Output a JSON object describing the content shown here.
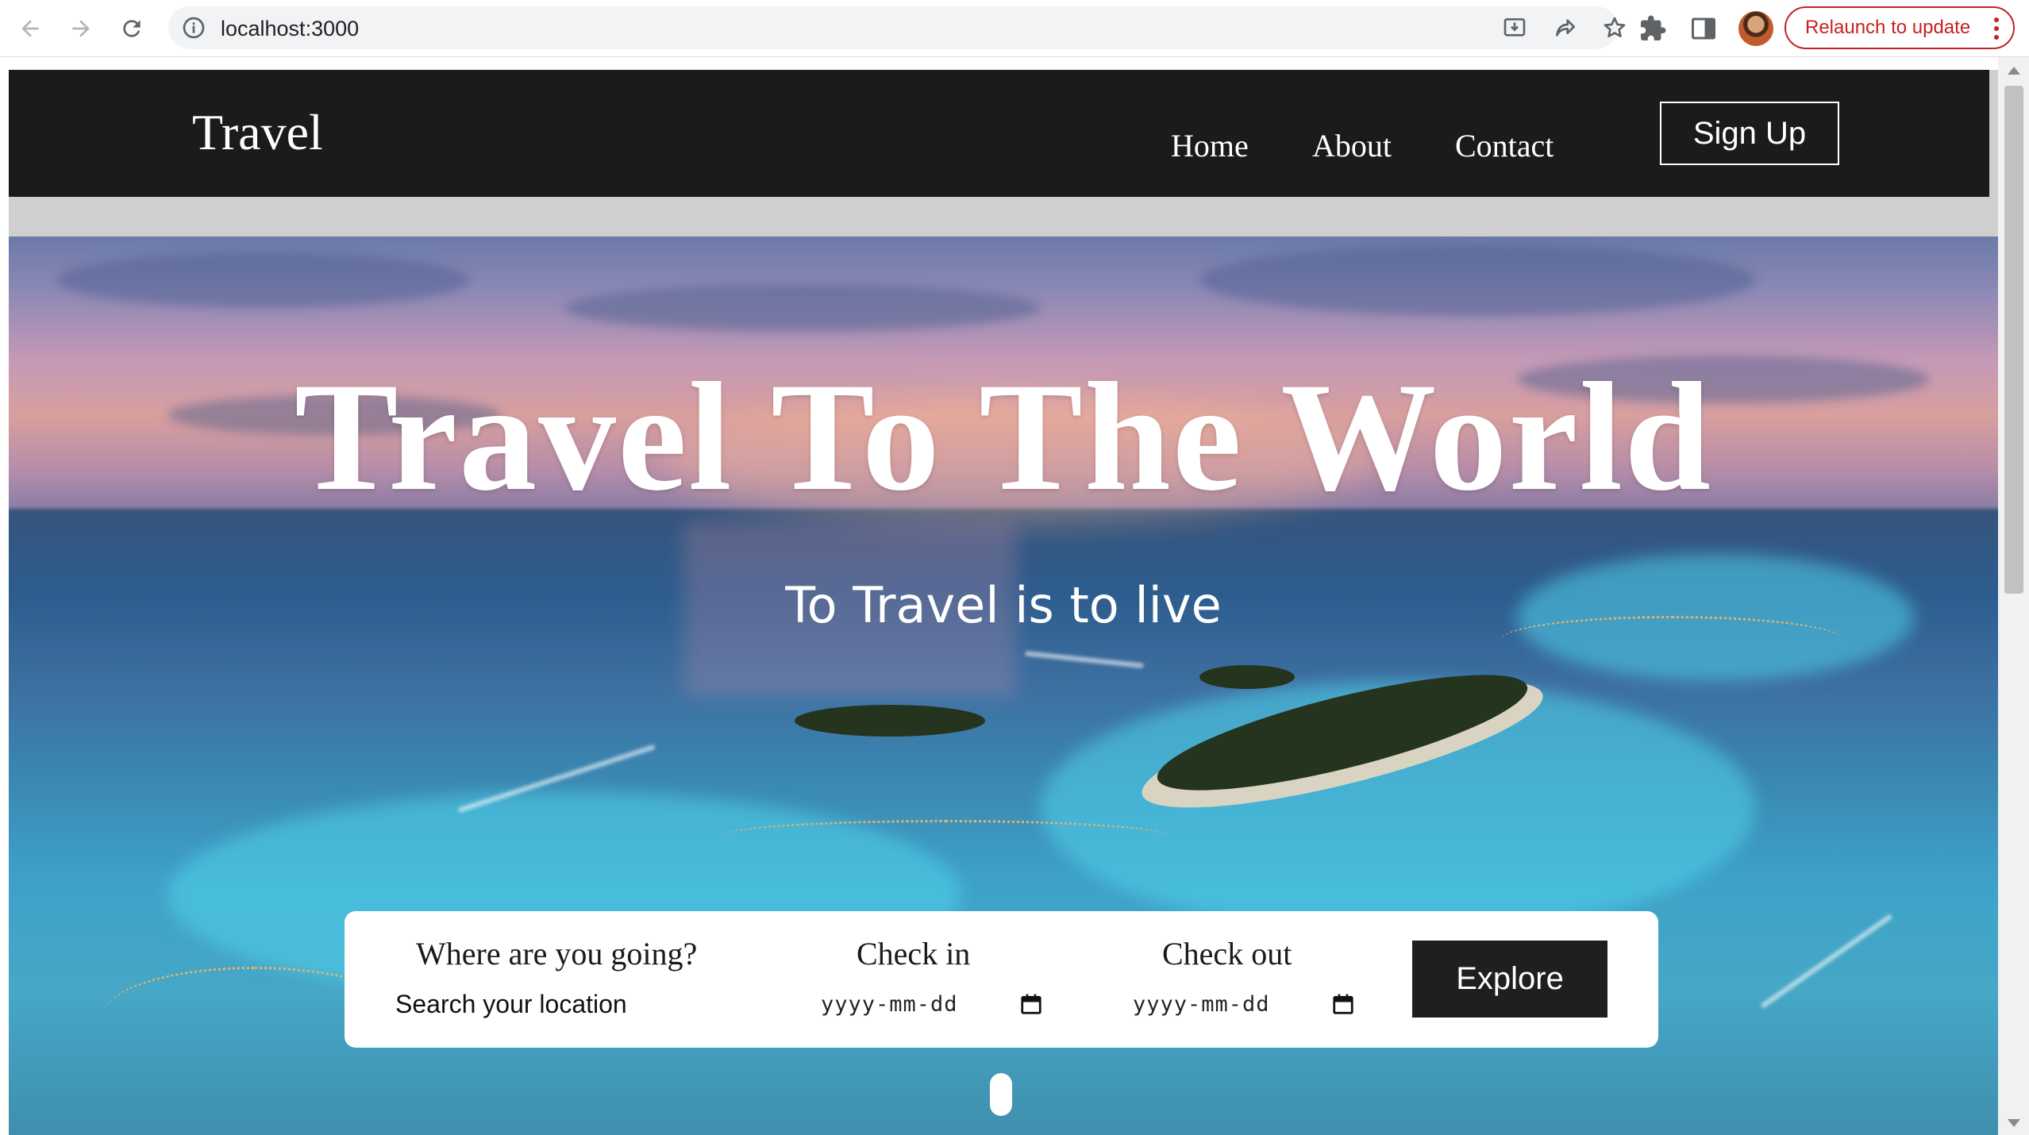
{
  "browser": {
    "url": "localhost:3000",
    "relaunch_label": "Relaunch to update",
    "accent_color": "#c5221f"
  },
  "site": {
    "logo": "Travel",
    "nav": [
      {
        "label": "Home"
      },
      {
        "label": "About"
      },
      {
        "label": "Contact"
      }
    ],
    "signup_label": "Sign Up"
  },
  "hero": {
    "title": "Travel To The World",
    "tagline": "To Travel is to live"
  },
  "search": {
    "location_label": "Where are you going?",
    "location_placeholder": "Search your location",
    "checkin_label": "Check in",
    "checkin_value": "yyyy-mm-dd",
    "checkout_label": "Check out",
    "checkout_value": "yyyy-mm-dd",
    "explore_label": "Explore"
  }
}
